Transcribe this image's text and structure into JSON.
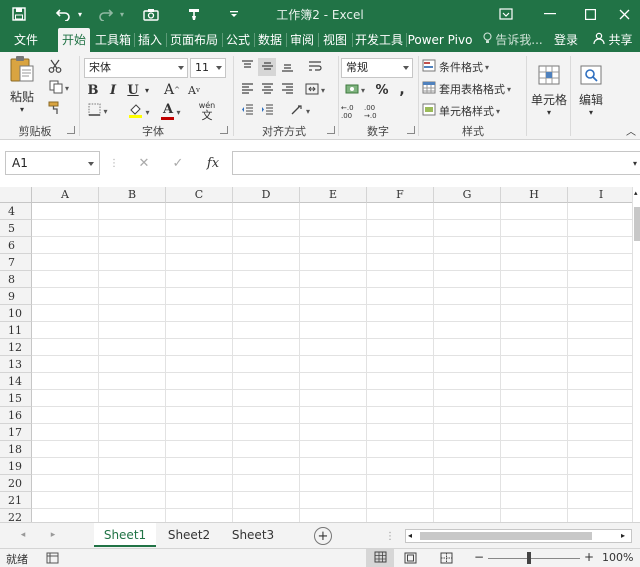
{
  "titlebar": {
    "title": "工作簿2 - Excel",
    "save_icon": "save-icon",
    "undo_icon": "undo-icon",
    "redo_icon": "redo-icon",
    "camera_icon": "camera-icon",
    "format_painter_icon": "format-painter-icon",
    "customize_icon": "customize-qat-icon"
  },
  "tabs": [
    {
      "label": "文件"
    },
    {
      "label": "开始"
    },
    {
      "label": "工具箱"
    },
    {
      "label": "插入"
    },
    {
      "label": "页面布局"
    },
    {
      "label": "公式"
    },
    {
      "label": "数据"
    },
    {
      "label": "审阅"
    },
    {
      "label": "视图"
    },
    {
      "label": "开发工具"
    },
    {
      "label": "Power Pivo"
    }
  ],
  "tell_me": "告诉我...",
  "login": "登录",
  "share": "共享",
  "ribbon": {
    "clipboard": {
      "paste": "粘贴",
      "label": "剪贴板"
    },
    "font": {
      "name": "宋体",
      "size": "11",
      "label": "字体",
      "bold": "B",
      "italic": "I",
      "underline": "U",
      "grow": "A",
      "shrink": "A",
      "font_color_letter": "A",
      "wen": "wén",
      "wen_char": "文"
    },
    "alignment": {
      "label": "对齐方式"
    },
    "number": {
      "format": "常规",
      "percent": "%",
      "comma": ",",
      "label": "数字",
      "inc_decimal": "←.0 .00",
      "dec_decimal": ".00 →.0"
    },
    "styles": {
      "conditional": "条件格式",
      "table": "套用表格格式",
      "cell_styles": "单元格样式",
      "label": "样式"
    },
    "cells": {
      "label": "单元格"
    },
    "editing": {
      "label": "编辑"
    }
  },
  "formula_bar": {
    "name_box": "A1",
    "cancel": "✕",
    "enter": "✓",
    "fx": "fx",
    "content": ""
  },
  "grid": {
    "columns": [
      "A",
      "B",
      "C",
      "D",
      "E",
      "F",
      "G",
      "H",
      "I"
    ],
    "rows": [
      "4",
      "5",
      "6",
      "7",
      "8",
      "9",
      "10",
      "11",
      "12",
      "13",
      "14",
      "15",
      "16",
      "17",
      "18",
      "19",
      "20",
      "21",
      "22"
    ]
  },
  "sheets": {
    "tabs": [
      "Sheet1",
      "Sheet2",
      "Sheet3"
    ],
    "active": "Sheet1",
    "add": "+"
  },
  "status": {
    "ready": "就绪",
    "zoom": "100%",
    "zoom_minus": "−",
    "zoom_plus": "+"
  },
  "colors": {
    "accent": "#217346",
    "ribbon_bg": "#f3f3f3",
    "font_color_bar": "#c00000",
    "fill_color_bar": "#ffff00"
  }
}
